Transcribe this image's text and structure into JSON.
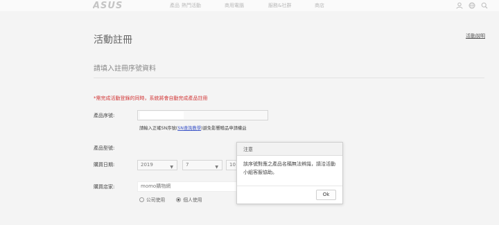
{
  "header": {
    "logo_text": "ASUS",
    "nav": [
      "產品",
      "熱門活動",
      "商用電腦",
      "服務&社群",
      "商店"
    ],
    "icons": [
      "user-icon",
      "globe-icon",
      "search-icon"
    ]
  },
  "page": {
    "title": "活動註冊",
    "top_link": "活動說明",
    "section_title": "請填入註冊序號資料",
    "warning": "*需完成活動登錄的同時，系統將會自動完成產品註冊"
  },
  "form": {
    "serial_label": "產品序號:",
    "serial_value": "",
    "serial_hint_before": "請輸入正確SN序號(",
    "serial_hint_link": "SN查詢教學",
    "serial_hint_after": ")避免影響贈品申請權益",
    "model_label": "產品型號:",
    "date_label": "購買日期:",
    "date_year": "2019",
    "date_month": "7",
    "date_day": "10",
    "store_label": "購買店家:",
    "store_value": "momo購物網",
    "usage_options": [
      "公司使用",
      "個人使用"
    ],
    "usage_selected": 1
  },
  "dialog": {
    "title": "注意",
    "message": "該序號對應之產品名稱無法辨識，請洽活動小組客服協助。",
    "ok_label": "Ok"
  }
}
